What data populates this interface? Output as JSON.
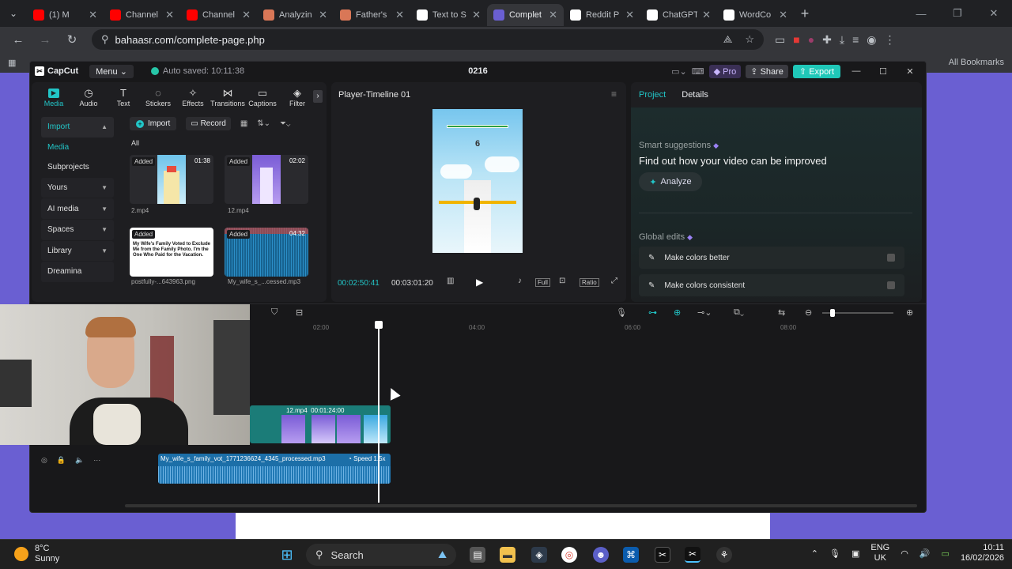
{
  "browser": {
    "tabs": [
      {
        "title": "(1) M",
        "favicon": "youtube-icon",
        "color": "#ff0000",
        "active": false
      },
      {
        "title": "Channel",
        "favicon": "youtube-studio-icon",
        "color": "#ff0000",
        "active": false
      },
      {
        "title": "Channel",
        "favicon": "youtube-studio-icon",
        "color": "#ff0000",
        "active": false
      },
      {
        "title": "Analyzin",
        "favicon": "claude-icon",
        "color": "#d97757",
        "active": false
      },
      {
        "title": "Father's",
        "favicon": "claude-icon",
        "color": "#d97757",
        "active": false
      },
      {
        "title": "Text to S",
        "favicon": "doc-icon",
        "color": "#ffffff",
        "active": false
      },
      {
        "title": "Complet",
        "favicon": "site-icon",
        "color": "#6a5fd2",
        "active": true
      },
      {
        "title": "Reddit P",
        "favicon": "send-icon",
        "color": "#ffffff",
        "active": false
      },
      {
        "title": "ChatGPT",
        "favicon": "chatgpt-icon",
        "color": "#ffffff",
        "active": false
      },
      {
        "title": "WordCo",
        "favicon": "w-icon",
        "color": "#ffffff",
        "active": false
      }
    ],
    "url": "bahaasr.com/complete-page.php",
    "all_bookmarks": "All Bookmarks"
  },
  "capcut": {
    "logo": "CapCut",
    "menu": "Menu",
    "autosave": "Auto saved: 10:11:38",
    "project_name": "0216",
    "pro": "Pro",
    "share": "Share",
    "export": "Export",
    "categories": [
      {
        "label": "Media",
        "icon": "media-icon"
      },
      {
        "label": "Audio",
        "icon": "audio-icon"
      },
      {
        "label": "Text",
        "icon": "text-icon"
      },
      {
        "label": "Stickers",
        "icon": "stickers-icon"
      },
      {
        "label": "Effects",
        "icon": "effects-icon"
      },
      {
        "label": "Transitions",
        "icon": "transitions-icon"
      },
      {
        "label": "Captions",
        "icon": "captions-icon"
      },
      {
        "label": "Filter",
        "icon": "filter-icon"
      }
    ],
    "sidenav": [
      "Import",
      "Media",
      "Subprojects",
      "Yours",
      "AI media",
      "Spaces",
      "Library",
      "Dreamina"
    ],
    "media_tools": {
      "import": "Import",
      "record": "Record"
    },
    "all_label": "All",
    "media": [
      {
        "name": "2.mp4",
        "badge": "Added",
        "duration": "01:38"
      },
      {
        "name": "12.mp4",
        "badge": "Added",
        "duration": "02:02"
      },
      {
        "name": "postfully-...643963.png",
        "badge": "Added",
        "duration": "",
        "preview_text": "My Wife's Family Voted to Exclude Me from the Family Photo. I'm the One Who Paid for the Vacation."
      },
      {
        "name": "My_wife_s_...cessed.mp3",
        "badge": "Added",
        "duration": "04:32"
      }
    ],
    "player": {
      "title": "Player-Timeline 01",
      "current": "00:02:50:41",
      "total": "00:03:01:20",
      "full": "Full",
      "ratio": "Ratio",
      "game_counter": "6"
    },
    "right": {
      "tabs": [
        "Project",
        "Details"
      ],
      "smart_label": "Smart suggestions",
      "smart_title": "Find out how your video can be improved",
      "analyze": "Analyze",
      "global_label": "Global edits",
      "edits": [
        "Make colors better",
        "Make colors consistent"
      ]
    },
    "timeline": {
      "ruler": [
        "02:00",
        "04:00",
        "06:00",
        "08:00"
      ],
      "video_clip": {
        "name": "12.mp4",
        "duration": "00:01:24:00"
      },
      "audio_clip": {
        "name": "My_wife_s_family_vot_1771236624_4345_processed.mp3",
        "speed": "Speed 1.5x"
      }
    }
  },
  "taskbar": {
    "temp": "8°C",
    "cond": "Sunny",
    "search": "Search",
    "lang1": "ENG",
    "lang2": "UK",
    "time": "10:11",
    "date": "16/02/2026"
  }
}
